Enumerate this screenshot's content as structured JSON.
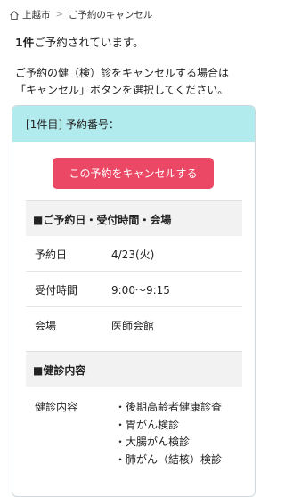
{
  "breadcrumb": {
    "home": "上越市",
    "separator": ">",
    "current": "ご予約のキャンセル"
  },
  "summary": {
    "count": "1件",
    "text": "ご予約されています。"
  },
  "instruction": {
    "line1": "ご予約の健（検）診をキャンセルする場合は",
    "line2": "「キャンセル」ボタンを選択してください。"
  },
  "reservation": {
    "header": "[1件目] 予約番号：",
    "cancel_button": "この予約をキャンセルする",
    "section_datetime": "■ご予約日・受付時間・会場",
    "date_label": "予約日",
    "date_value": "4/23(火)",
    "time_label": "受付時間",
    "time_value": "9:00〜9:15",
    "venue_label": "会場",
    "venue_value": "医師会館",
    "section_exam": "■健診内容",
    "exam_label": "健診内容",
    "exams": [
      "後期高齢者健康診査",
      "胃がん検診",
      "大腸がん検診",
      "肺がん（結核）検診"
    ]
  },
  "colors": {
    "header_bg": "#b2ebee",
    "button_bg": "#ea4865"
  }
}
